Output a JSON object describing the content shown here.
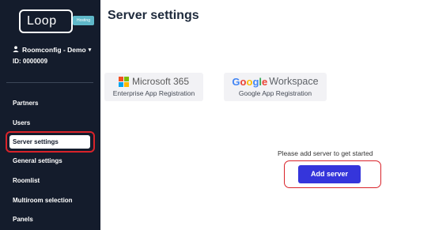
{
  "sidebar": {
    "logo_text": "Loop",
    "logo_badge": "Hosting",
    "user_name": "Roomconfig - Demo",
    "user_id": "ID: 0000009",
    "items": [
      {
        "label": "Partners"
      },
      {
        "label": "Users"
      },
      {
        "label": "Server settings",
        "active": true
      },
      {
        "label": "General settings"
      },
      {
        "label": "Roomlist"
      },
      {
        "label": "Multiroom selection"
      },
      {
        "label": "Panels"
      }
    ]
  },
  "main": {
    "title": "Server settings",
    "cards": {
      "microsoft": {
        "brand": "Microsoft 365",
        "subtitle": "Enterprise App Registration"
      },
      "google": {
        "brand_google": "Google",
        "brand_workspace": "Workspace",
        "subtitle": "Google App Registration"
      }
    },
    "prompt": "Please add server to get started",
    "add_button": "Add server"
  },
  "colors": {
    "sidebar_bg": "#141c2c",
    "accent_button": "#3535db",
    "highlight_red": "#d9232a"
  }
}
